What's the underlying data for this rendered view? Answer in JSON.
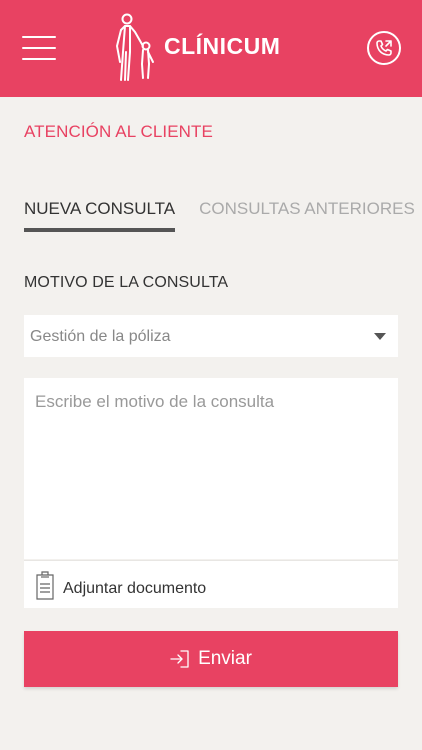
{
  "header": {
    "brand": "CLÍNICUM",
    "menu_icon": "hamburger-menu-icon",
    "phone_icon": "phone-call-icon",
    "color": "#e84262"
  },
  "page": {
    "section_title": "ATENCIÓN AL CLIENTE"
  },
  "tabs": [
    {
      "label": "NUEVA CONSULTA",
      "active": true
    },
    {
      "label": "CONSULTAS ANTERIORES",
      "active": false
    }
  ],
  "form": {
    "reason_label": "MOTIVO DE LA CONSULTA",
    "reason_select": {
      "value": "Gestión de la póliza"
    },
    "message_placeholder": "Escribe el motivo de la consulta",
    "attach_label": "Adjuntar documento",
    "attach_icon": "clipboard-document-icon",
    "send_label": "Enviar",
    "send_icon": "sign-in-arrow-icon"
  }
}
